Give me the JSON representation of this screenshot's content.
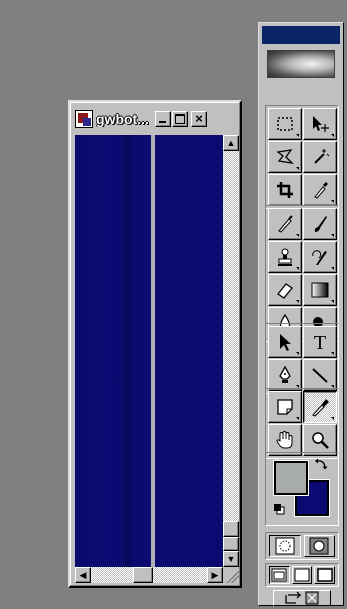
{
  "document_window": {
    "title": "gwbot...",
    "minimize_label": "",
    "maximize_label": "",
    "close_label": "×",
    "scroll_up": "▲",
    "scroll_down": "▼",
    "scroll_left": "◀",
    "scroll_right": "▶"
  },
  "toolbox": {
    "tools": [
      [
        "marquee-icon",
        "move-icon"
      ],
      [
        "lasso-icon",
        "magic-wand-icon"
      ],
      [
        "crop-icon",
        "eyedropper-small-icon"
      ],
      [
        "airbrush-icon",
        "paintbrush-icon"
      ],
      [
        "rubber-stamp-icon",
        "history-brush-icon"
      ],
      [
        "eraser-icon",
        "gradient-icon"
      ],
      [
        "blur-icon",
        "burn-icon"
      ],
      [
        "path-select-icon",
        "type-icon"
      ],
      [
        "pen-icon",
        "line-icon"
      ],
      [
        "notes-icon",
        "eyedropper-icon"
      ],
      [
        "hand-icon",
        "zoom-icon"
      ]
    ],
    "foreground_color": "#a8aca9",
    "background_color": "#0a0a72",
    "title_bar_color": "#0a2468",
    "selected_tool": "eyedropper-icon"
  }
}
